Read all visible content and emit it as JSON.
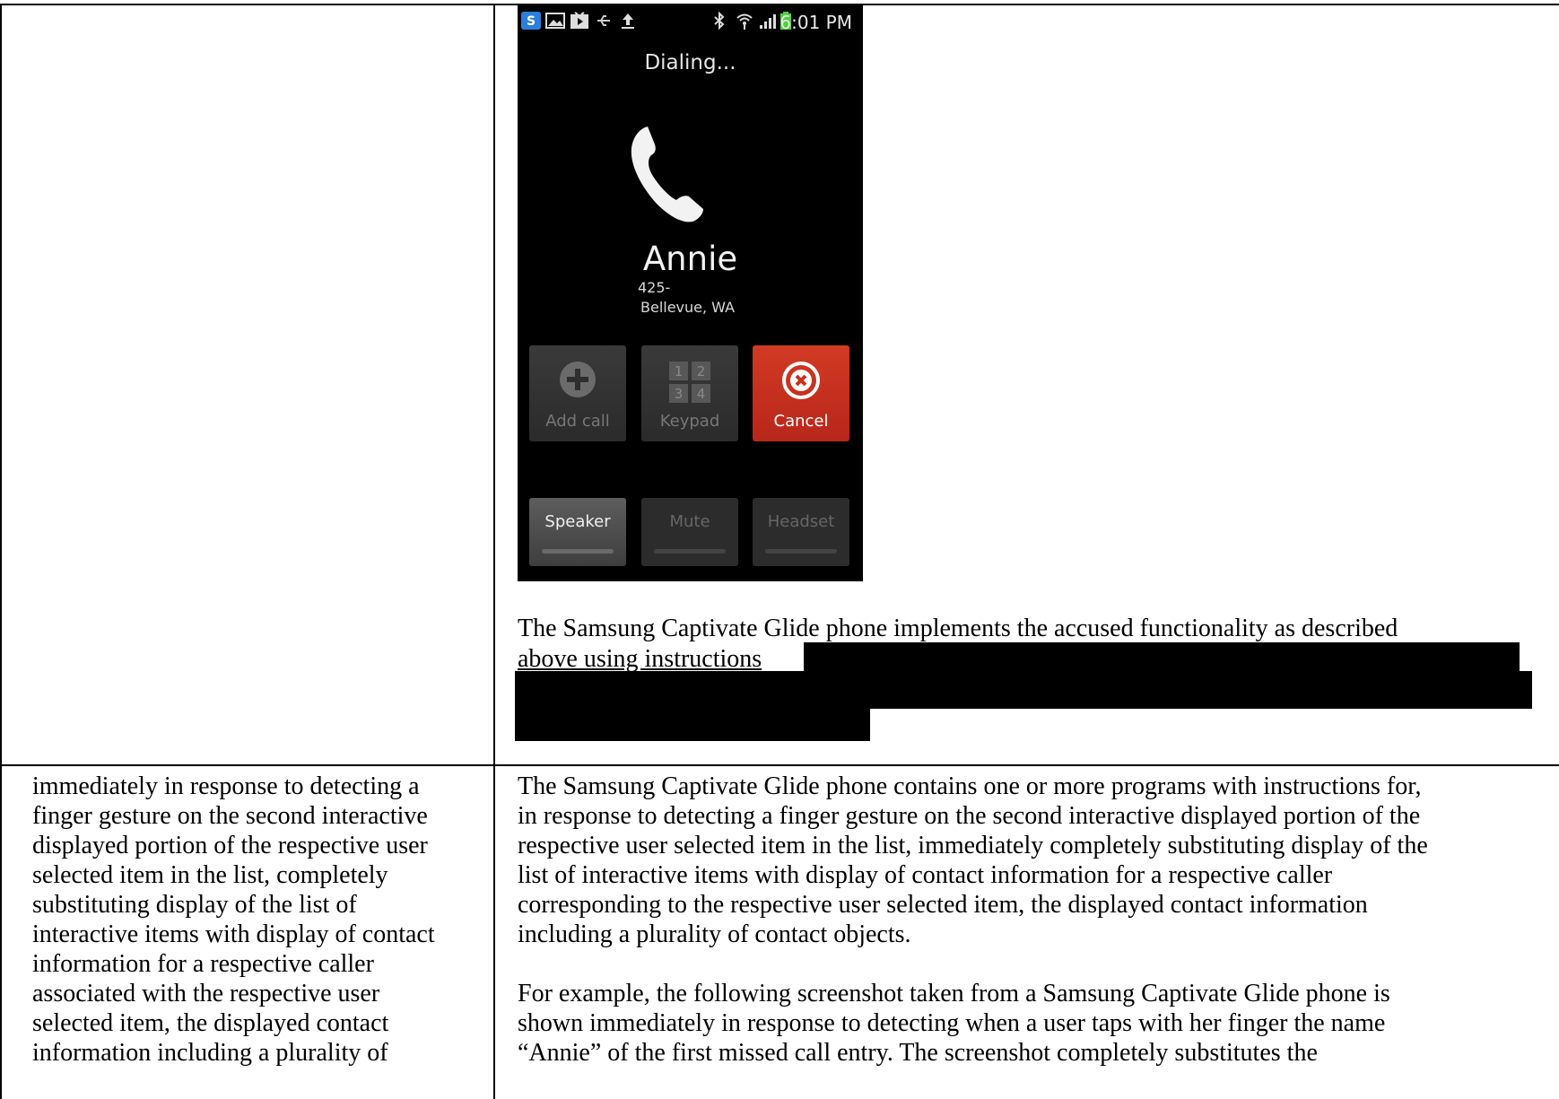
{
  "phone": {
    "status_time": "6:01 PM",
    "status_icons": [
      "skype-icon",
      "gallery-icon",
      "play-store-icon",
      "usb-icon",
      "upload-icon",
      "bluetooth-icon",
      "wifi-icon",
      "signal-icon",
      "battery-icon"
    ],
    "call_state": "Dialing...",
    "caller_name": "Annie",
    "caller_number": "425-",
    "caller_location": "Bellevue, WA",
    "buttons": {
      "add_call": "Add call",
      "keypad": "Keypad",
      "keypad_digits": [
        "1",
        "2",
        "3",
        "4"
      ],
      "cancel": "Cancel",
      "speaker": "Speaker",
      "mute": "Mute",
      "headset": "Headset"
    },
    "colors": {
      "cancel": "#c8301f",
      "screen_bg": "#000000"
    }
  },
  "upper_right": {
    "para_line1": "The Samsung Captivate Glide phone implements the accused functionality as described",
    "para_line2": "above using instructions"
  },
  "lower_left": {
    "lines": [
      "immediately in response to detecting a",
      "finger gesture on the second interactive",
      "displayed portion of the respective user",
      "selected item in the list, completely",
      "substituting display of the list of",
      "interactive items with display of contact",
      "information for a respective caller",
      "associated with the respective user",
      "selected item, the displayed contact",
      "information including a plurality of"
    ]
  },
  "lower_right": {
    "para1_lines": [
      "The Samsung Captivate Glide phone contains one or more programs with instructions for,",
      "in response to detecting a finger gesture on the second interactive displayed portion of the",
      "respective user selected item in the list, immediately completely substituting display of the",
      "list of interactive items with display of contact information for a respective caller",
      "corresponding to the respective user selected item, the displayed contact information",
      "including a plurality of contact objects."
    ],
    "para2_lines": [
      "For example, the following screenshot taken from a Samsung Captivate Glide phone is",
      "shown immediately in response to detecting when a user taps with her finger the name",
      "“Annie” of the first missed call entry.  The screenshot completely substitutes the"
    ]
  }
}
